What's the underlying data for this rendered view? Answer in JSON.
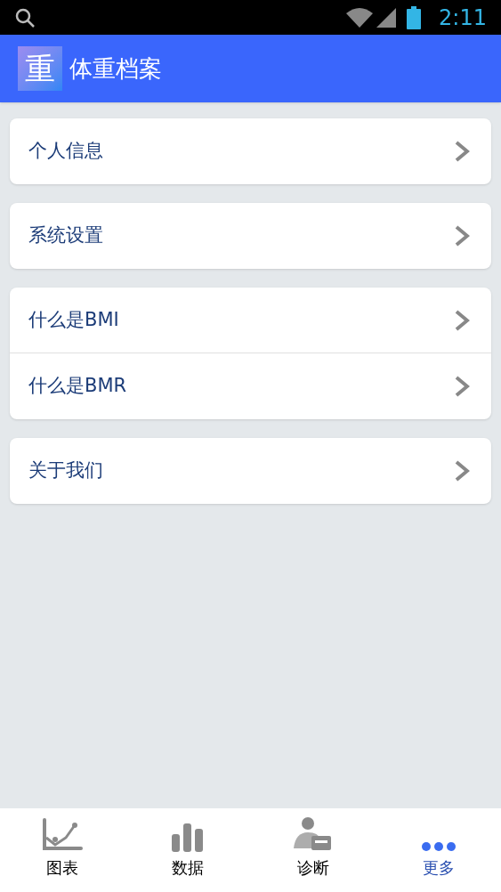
{
  "status_bar": {
    "time": "2:11"
  },
  "app_bar": {
    "logo": "重",
    "title": "体重档案"
  },
  "groups": [
    {
      "items": [
        "个人信息"
      ]
    },
    {
      "items": [
        "系统设置"
      ]
    },
    {
      "items": [
        "什么是BMI",
        "什么是BMR"
      ]
    },
    {
      "items": [
        "关于我们"
      ]
    }
  ],
  "bottom_nav": [
    {
      "label": "图表",
      "kind": "chart",
      "selected": false
    },
    {
      "label": "数据",
      "kind": "bars",
      "selected": false
    },
    {
      "label": "诊断",
      "kind": "person",
      "selected": false
    },
    {
      "label": "更多",
      "kind": "more",
      "selected": true
    }
  ]
}
